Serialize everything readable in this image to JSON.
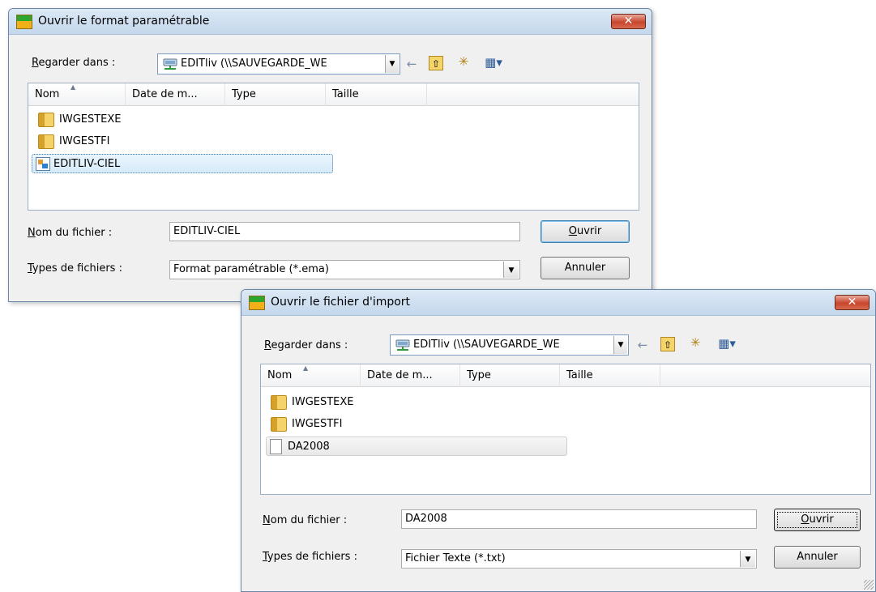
{
  "dialog1": {
    "title": "Ouvrir le format paramétrable",
    "close_label": "✕",
    "lookin_label_underline": "R",
    "lookin_label_rest": "egarder dans :",
    "lookin_value": "EDITliv (\\\\SAUVEGARDE_WE",
    "columns": [
      "Nom",
      "Date de m...",
      "Type",
      "Taille"
    ],
    "items": [
      {
        "name": "IWGESTEXE",
        "icon": "folder-icon"
      },
      {
        "name": "IWGESTFI",
        "icon": "folder-icon"
      },
      {
        "name": "EDITLIV-CIEL",
        "icon": "ema-file-icon"
      }
    ],
    "filename_label_underline": "N",
    "filename_label_rest": "om du fichier :",
    "filename_value": "EDITLIV-CIEL",
    "filetype_label_underline": "T",
    "filetype_label_rest": "ypes de fichiers :",
    "filetype_value": "Format paramétrable (*.ema)",
    "open_label_underline": "O",
    "open_label_rest": "uvrir",
    "cancel_label": "Annuler"
  },
  "dialog2": {
    "title": "Ouvrir le fichier d'import",
    "close_label": "✕",
    "lookin_label_underline": "R",
    "lookin_label_rest": "egarder dans :",
    "lookin_value": "EDITliv (\\\\SAUVEGARDE_WE",
    "columns": [
      "Nom",
      "Date de m...",
      "Type",
      "Taille"
    ],
    "items": [
      {
        "name": "IWGESTEXE",
        "icon": "folder-icon"
      },
      {
        "name": "IWGESTFI",
        "icon": "folder-icon"
      },
      {
        "name": "DA2008",
        "icon": "text-file-icon"
      }
    ],
    "filename_label_underline": "N",
    "filename_label_rest": "om du fichier :",
    "filename_value": "DA2008",
    "filetype_label_underline": "T",
    "filetype_label_rest": "ypes de fichiers :",
    "filetype_value": "Fichier Texte (*.txt)",
    "open_label_underline": "O",
    "open_label_rest": "uvrir",
    "cancel_label": "Annuler"
  },
  "icons": {
    "back": "←",
    "up_folder": "⇧",
    "new_folder": "✳",
    "view_menu": "▦▾"
  }
}
